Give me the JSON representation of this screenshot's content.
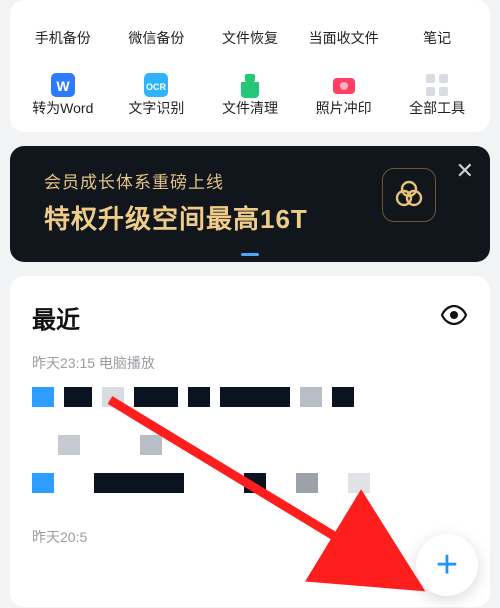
{
  "tools": {
    "row1": [
      {
        "label": "手机备份",
        "icon": "phone-backup"
      },
      {
        "label": "微信备份",
        "icon": "wechat-backup"
      },
      {
        "label": "文件恢复",
        "icon": "file-restore"
      },
      {
        "label": "当面收文件",
        "icon": "receive-file"
      },
      {
        "label": "笔记",
        "icon": "note"
      }
    ],
    "row2": [
      {
        "label": "转为Word",
        "icon": "to-word"
      },
      {
        "label": "文字识别",
        "icon": "ocr"
      },
      {
        "label": "文件清理",
        "icon": "file-clean"
      },
      {
        "label": "照片冲印",
        "icon": "photo-print"
      },
      {
        "label": "全部工具",
        "icon": "all-tools"
      }
    ]
  },
  "promo": {
    "subtitle": "会员成长体系重磅上线",
    "title": "特权升级空间最高16T"
  },
  "recent": {
    "title": "最近",
    "ts1": "昨天23:15  电脑播放",
    "ts2": "昨天20:5"
  }
}
